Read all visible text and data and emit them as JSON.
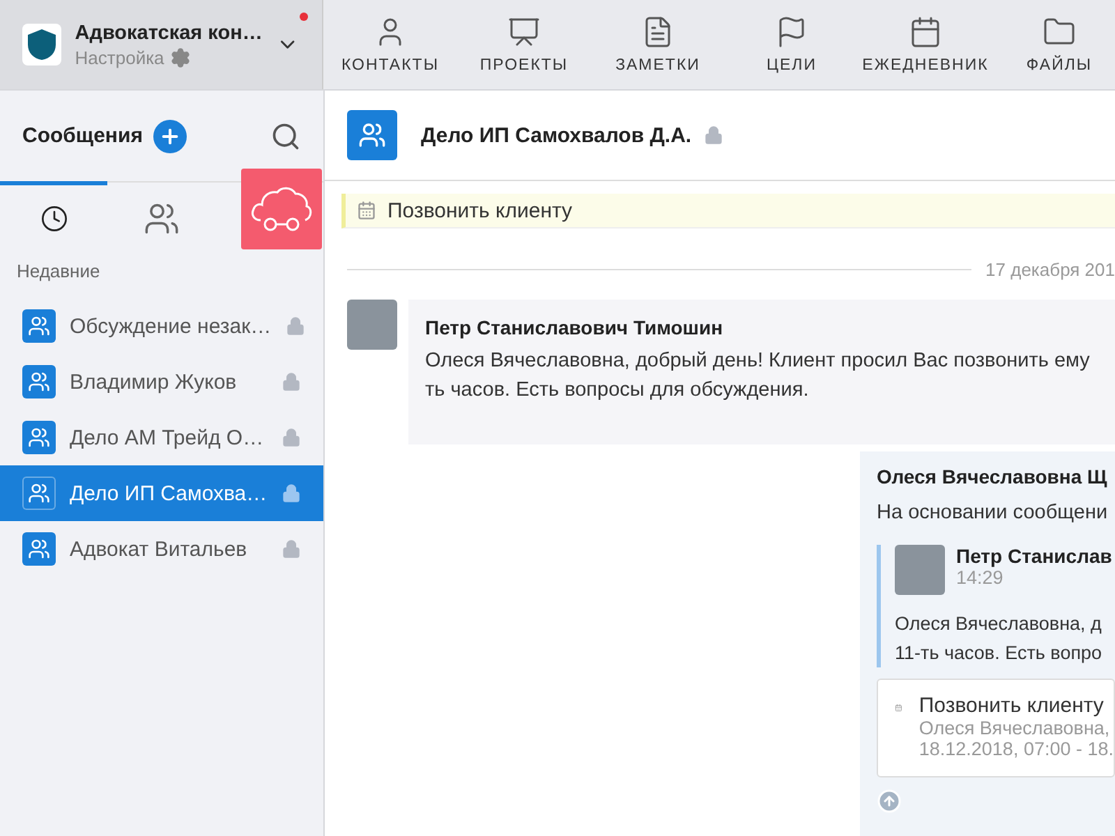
{
  "workspace": {
    "name": "Адвокатская кон…",
    "settings_label": "Настройка",
    "notification": true
  },
  "nav": [
    {
      "label": "КОНТАКТЫ",
      "kind": "user"
    },
    {
      "label": "ПРОЕКТЫ",
      "kind": "board"
    },
    {
      "label": "ЗАМЕТКИ",
      "kind": "note"
    },
    {
      "label": "ЦЕЛИ",
      "kind": "flag"
    },
    {
      "label": "ЕЖЕДНЕВНИК",
      "kind": "calendar"
    },
    {
      "label": "ФАЙЛЫ",
      "kind": "folder"
    }
  ],
  "sidebar": {
    "title": "Сообщения",
    "tabs": [
      {
        "kind": "recent",
        "selected": true
      },
      {
        "kind": "groups",
        "selected": false
      }
    ],
    "section": "Недавние",
    "items": [
      {
        "name": "Обсуждение незак…",
        "locked": true,
        "selected": false
      },
      {
        "name": "Владимир Жуков",
        "locked": true,
        "selected": false
      },
      {
        "name": "Дело АМ Трейд О…",
        "locked": true,
        "selected": false
      },
      {
        "name": "Дело ИП Самохва…",
        "locked": true,
        "selected": true
      },
      {
        "name": "Адвокат Витальев",
        "locked": true,
        "selected": false
      }
    ]
  },
  "chat": {
    "title": "Дело ИП Самохвалов Д.А.",
    "locked": true,
    "pinned": "Позвонить клиенту",
    "date": "17 декабря 201",
    "message": {
      "author": "Петр Станиславович Тимошин",
      "lines": [
        "Олеся Вячеславовна, добрый день! Клиент просил Вас позвонить ему",
        "ть часов. Есть вопросы для обсуждения."
      ]
    },
    "reply": {
      "author": "Олеся Вячеславовна Щ",
      "text": "На основании сообщени",
      "quote": {
        "author": "Петр Станислав",
        "time": "14:29",
        "lines": [
          "Олеся Вячеславовна, д",
          "11-ть часов. Есть вопро"
        ]
      },
      "task": {
        "title": "Позвонить клиенту",
        "assignee": "Олеся Вячеславовна,",
        "period": "18.12.2018, 07:00 - 18."
      }
    }
  }
}
